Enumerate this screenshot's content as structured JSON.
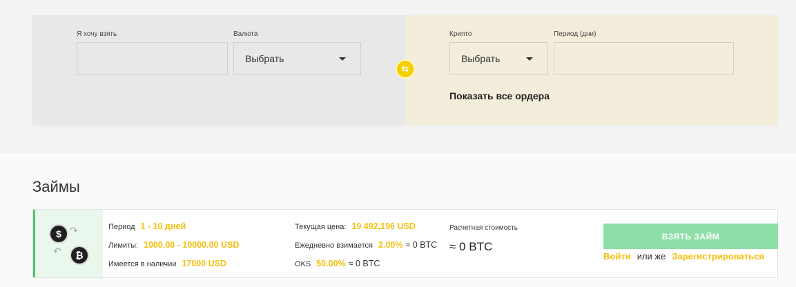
{
  "filter": {
    "want_label": "Я хочу взять",
    "currency_label": "Валюта",
    "currency_value": "Выбрать",
    "crypto_label": "Крипто",
    "crypto_value": "Выбрать",
    "period_label": "Период (дни)",
    "show_orders": "Показать все ордера",
    "swap_icon": "⇆"
  },
  "section": {
    "title": "Займы"
  },
  "loan": {
    "period_label": "Период",
    "period_value": "1 - 10 дней",
    "limits_label": "Лимиты:",
    "limits_value": "1000.00 - 10000.00 USD",
    "available_label": "Имеется в наличии",
    "available_value": "17000 USD",
    "price_label": "Текущая цена:",
    "price_value": "19 492,196 USD",
    "daily_label": "Ежедневно взимается",
    "daily_value": "2.00%",
    "daily_btc": "≈ 0 BTC",
    "oks_label": "OKS",
    "oks_value": "50.00%",
    "oks_btc": "≈ 0 BTC",
    "calc_label": "Расчетная стоимость",
    "calc_value": "≈ 0 BTC",
    "take_button": "ВЗЯТЬ ЗАЙМ",
    "login": "Войти",
    "or": "или же",
    "register": "Зарегистрироваться",
    "coin_usd": "$",
    "coin_btc": "₿"
  }
}
